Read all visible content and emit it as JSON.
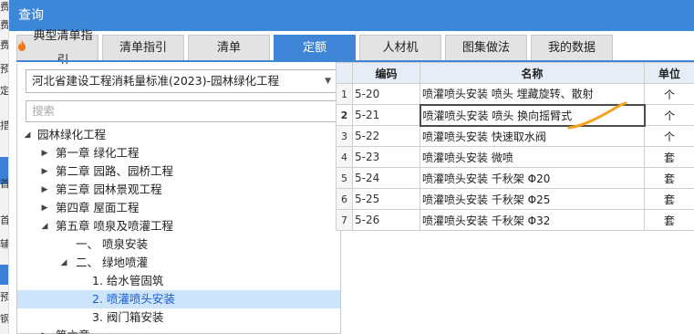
{
  "window": {
    "title": "查询"
  },
  "tabs": [
    {
      "label": "典型清单指引",
      "icon": "fire-icon",
      "active": false
    },
    {
      "label": "清单指引",
      "active": false
    },
    {
      "label": "清单",
      "active": false
    },
    {
      "label": "定额",
      "active": true
    },
    {
      "label": "人材机",
      "active": false
    },
    {
      "label": "图集做法",
      "active": false
    },
    {
      "label": "我的数据",
      "active": false
    }
  ],
  "library_select": {
    "value": "河北省建设工程消耗量标准(2023)-园林绿化工程"
  },
  "search": {
    "placeholder": "搜索"
  },
  "tree": [
    {
      "label": "园林绿化工程",
      "toggle": "expanded",
      "level": 0
    },
    {
      "label": "第一章 绿化工程",
      "toggle": "collapsed",
      "level": 1
    },
    {
      "label": "第二章 园路、园桥工程",
      "toggle": "collapsed",
      "level": 1
    },
    {
      "label": "第三章 园林景观工程",
      "toggle": "collapsed",
      "level": 1
    },
    {
      "label": "第四章 屋面工程",
      "toggle": "collapsed",
      "level": 1
    },
    {
      "label": "第五章 喷泉及喷灌工程",
      "toggle": "expanded",
      "level": 1
    },
    {
      "label": "一、 喷泉安装",
      "toggle": "none",
      "level": 2
    },
    {
      "label": "二、 绿地喷灌",
      "toggle": "expanded",
      "level": 2
    },
    {
      "label": "1. 给水管固筑",
      "toggle": "none",
      "level": 3
    },
    {
      "label": "2. 喷灌喷头安装",
      "toggle": "none",
      "level": 3,
      "selected": true
    },
    {
      "label": "3. 阀门箱安装",
      "toggle": "none",
      "level": 3
    },
    {
      "label": "第六章 ...",
      "toggle": "collapsed",
      "level": 1
    }
  ],
  "table": {
    "headers": {
      "code": "编码",
      "name": "名称",
      "unit": "单位"
    },
    "rows": [
      {
        "idx": "1",
        "code": "5-20",
        "name": "喷灌喷头安装 喷头 埋藏旋转、散射",
        "unit": "个"
      },
      {
        "idx": "2",
        "code": "5-21",
        "name": "喷灌喷头安装 喷头 换向摇臂式",
        "unit": "个",
        "current": true
      },
      {
        "idx": "3",
        "code": "5-22",
        "name": "喷灌喷头安装 快速取水阀",
        "unit": "个"
      },
      {
        "idx": "4",
        "code": "5-23",
        "name": "喷灌喷头安装 微喷",
        "unit": "套"
      },
      {
        "idx": "5",
        "code": "5-24",
        "name": "喷灌喷头安装 千秋架 Φ20",
        "unit": "套"
      },
      {
        "idx": "6",
        "code": "5-25",
        "name": "喷灌喷头安装 千秋架 Φ25",
        "unit": "套"
      },
      {
        "idx": "7",
        "code": "5-26",
        "name": "喷灌喷头安装 千秋架 Φ32",
        "unit": "套"
      }
    ]
  },
  "background": {
    "strip_chars": [
      "费",
      "费",
      "费",
      "预",
      "定",
      "措",
      "首",
      "首",
      "辅",
      "预",
      "钢"
    ]
  },
  "colors": {
    "accent": "#3f86d9",
    "title_bg": "#3d87d8",
    "selection": "#cce5fb",
    "annotation": "#f4a41c"
  }
}
